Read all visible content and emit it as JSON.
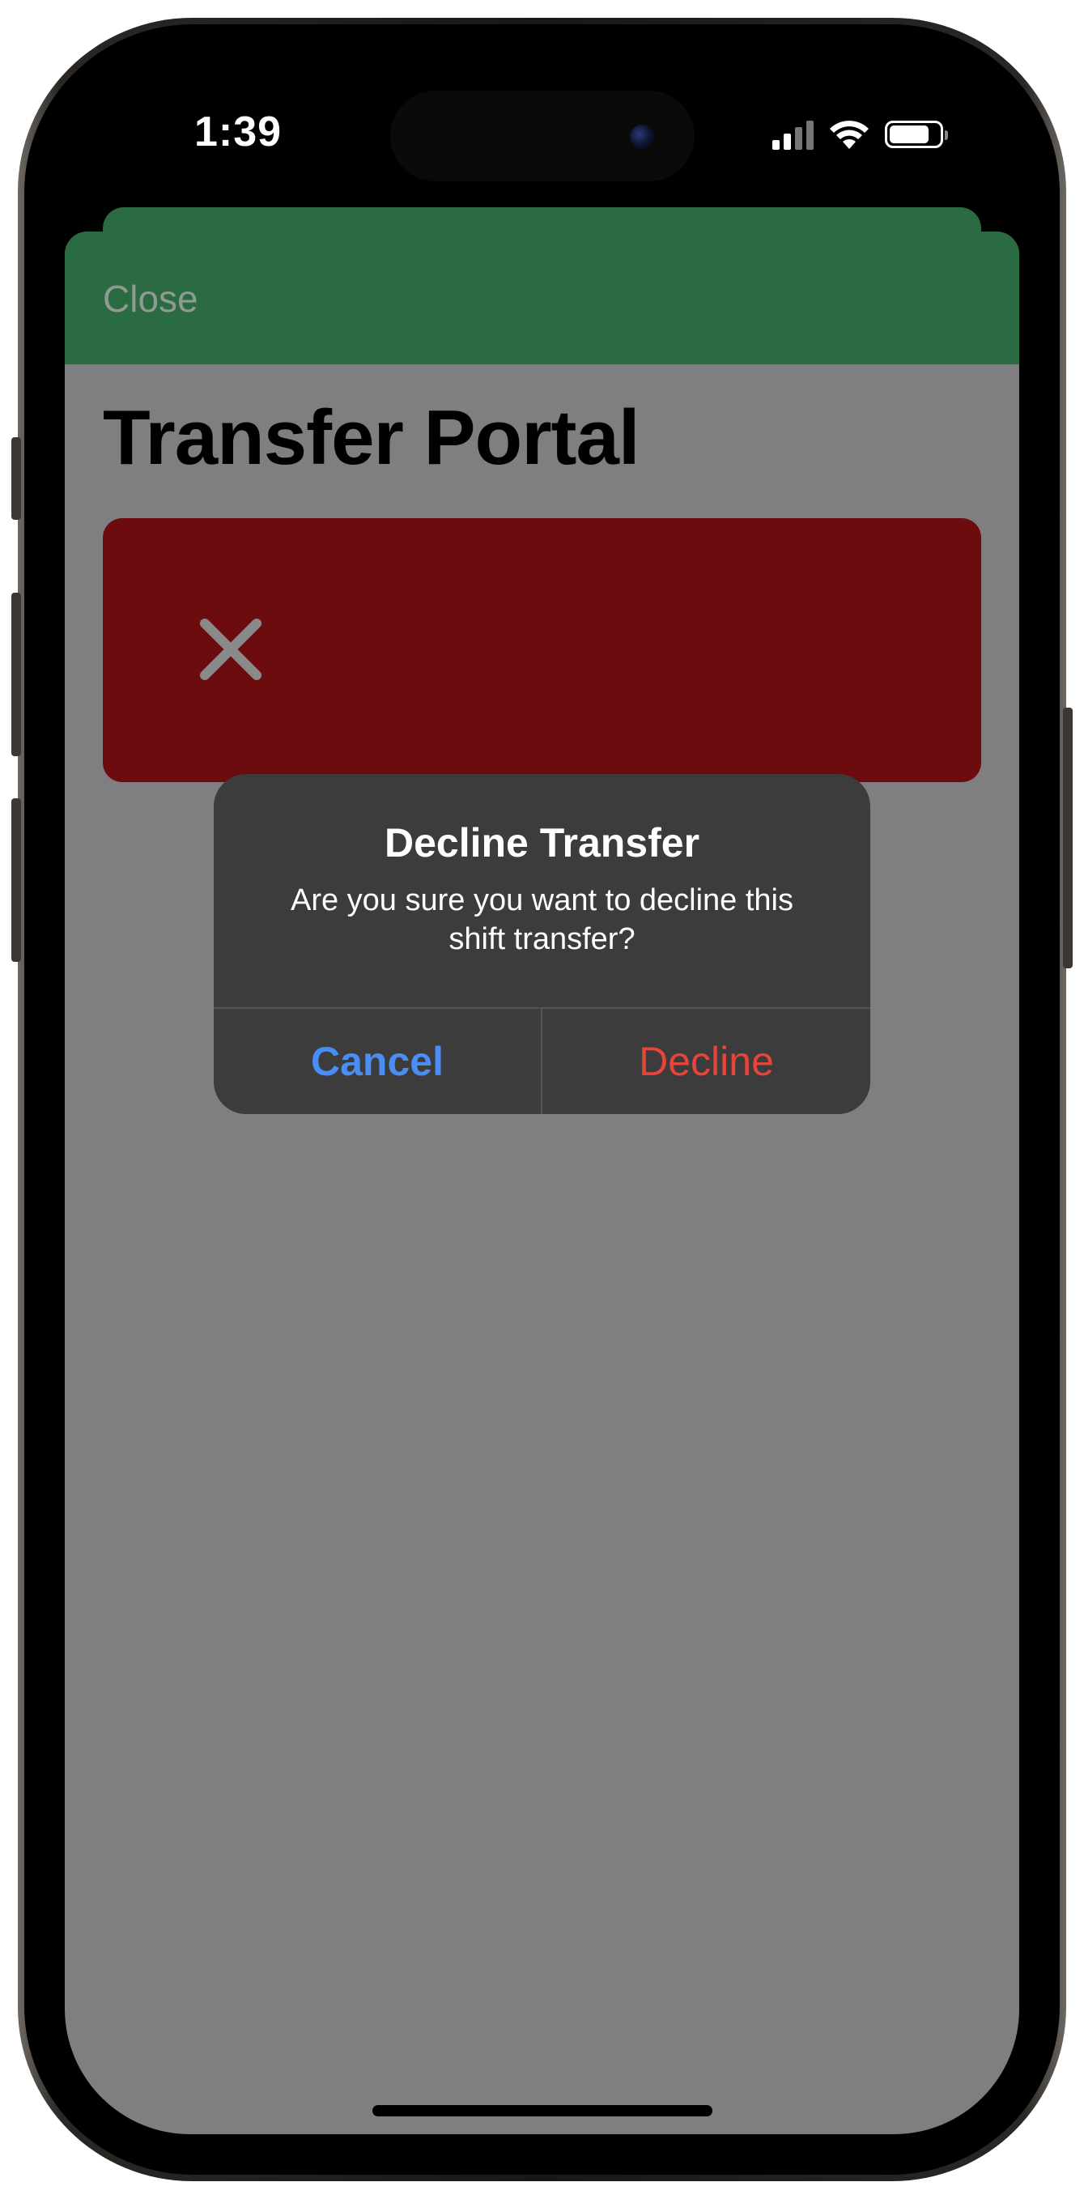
{
  "status_bar": {
    "time": "1:39",
    "icons": [
      "cellular-signal-icon",
      "wifi-icon",
      "battery-icon"
    ]
  },
  "nav": {
    "close_label": "Close"
  },
  "page": {
    "title": "Transfer Portal",
    "banner_icon": "x-mark-icon"
  },
  "alert": {
    "title": "Decline Transfer",
    "message": "Are you sure you want to decline this shift transfer?",
    "cancel_label": "Cancel",
    "decline_label": "Decline"
  },
  "colors": {
    "nav_green": "#2b6b42",
    "banner_red": "#6d0c0e",
    "cancel_blue": "#4a8ef5",
    "decline_red": "#e8443a",
    "dim_overlay": "#7f7f81",
    "alert_bg": "#3c3c3c"
  }
}
